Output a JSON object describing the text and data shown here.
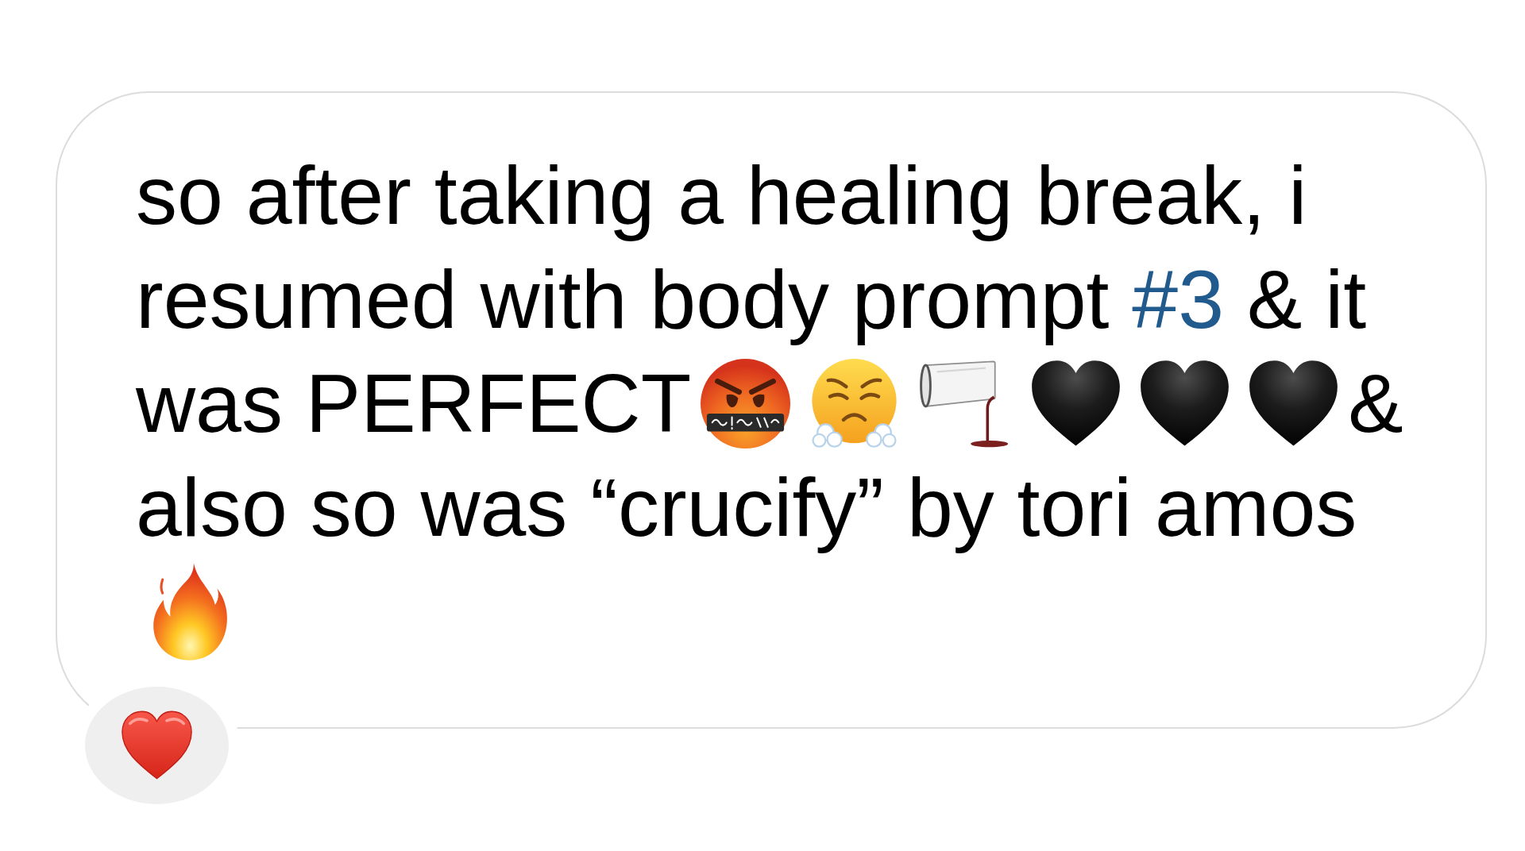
{
  "message": {
    "lines": [
      [
        {
          "kind": "text",
          "text": "so after taking a healing break, i"
        }
      ],
      [
        {
          "kind": "text",
          "text": "resumed with body prompt "
        },
        {
          "kind": "hashtag",
          "text": "#3"
        },
        {
          "kind": "text",
          "text": " & it"
        }
      ],
      [
        {
          "kind": "text",
          "text": "was PERFECT"
        },
        {
          "kind": "cursing"
        },
        {
          "kind": "steaming"
        },
        {
          "kind": "spill"
        },
        {
          "kind": "blackheart"
        },
        {
          "kind": "blackheart"
        },
        {
          "kind": "blackheart"
        },
        {
          "kind": "text",
          "text": "&"
        }
      ],
      [
        {
          "kind": "text",
          "text": "also so was “crucify” by tori amos"
        }
      ],
      [
        {
          "kind": "fire"
        }
      ]
    ]
  },
  "reactions": [
    {
      "kind": "heart"
    }
  ]
}
